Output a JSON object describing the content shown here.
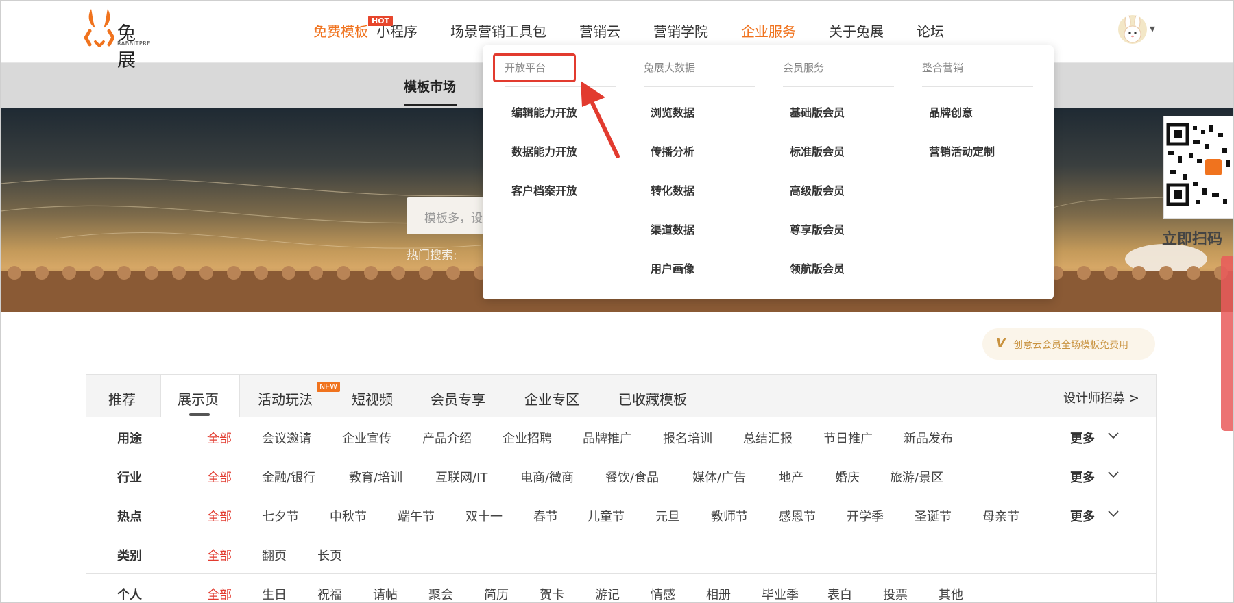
{
  "header": {
    "logo_text": "兔展",
    "logo_sub": "RABBITPRE",
    "nav": [
      {
        "label": "免费模板",
        "style": "orange"
      },
      {
        "label": "小程序"
      },
      {
        "label": "场景营销工具包"
      },
      {
        "label": "营销云"
      },
      {
        "label": "营销学院"
      },
      {
        "label": "企业服务",
        "style": "orange"
      },
      {
        "label": "关于兔展"
      },
      {
        "label": "论坛"
      }
    ],
    "hot_badge": "HOT",
    "avatar_caret": "▾"
  },
  "subbar": {
    "tab": "模板市场"
  },
  "hero": {
    "search_placeholder": "模板多，设",
    "hot_search": "热门搜索:",
    "qr_text": "立即扫码"
  },
  "dropdown": {
    "columns": [
      {
        "heading": "开放平台",
        "items": [
          "编辑能力开放",
          "数据能力开放",
          "客户档案开放"
        ]
      },
      {
        "heading": "兔展大数据",
        "items": [
          "浏览数据",
          "传播分析",
          "转化数据",
          "渠道数据",
          "用户画像"
        ]
      },
      {
        "heading": "会员服务",
        "items": [
          "基础版会员",
          "标准版会员",
          "高级版会员",
          "尊享版会员",
          "领航版会员"
        ]
      },
      {
        "heading": "整合营销",
        "items": [
          "品牌创意",
          "营销活动定制"
        ]
      }
    ]
  },
  "vip": {
    "icon": "V",
    "text": "创意云会员全场模板免费用"
  },
  "tabs": {
    "items": [
      "推荐",
      "展示页",
      "活动玩法",
      "短视频",
      "会员专享",
      "企业专区",
      "已收藏模板"
    ],
    "active_index": 1,
    "new_badge": "NEW",
    "designer": "设计师招募 >"
  },
  "filters": [
    {
      "label": "用途",
      "all": "全部",
      "items": [
        "会议邀请",
        "企业宣传",
        "产品介绍",
        "企业招聘",
        "品牌推广",
        "报名培训",
        "总结汇报",
        "节日推广",
        "新品发布"
      ],
      "more": "更多"
    },
    {
      "label": "行业",
      "all": "全部",
      "items": [
        "金融/银行",
        "教育/培训",
        "互联网/IT",
        "电商/微商",
        "餐饮/食品",
        "媒体/广告",
        "地产",
        "婚庆",
        "旅游/景区"
      ],
      "more": "更多"
    },
    {
      "label": "热点",
      "all": "全部",
      "items": [
        "七夕节",
        "中秋节",
        "端午节",
        "双十一",
        "春节",
        "儿童节",
        "元旦",
        "教师节",
        "感恩节",
        "开学季",
        "圣诞节",
        "母亲节"
      ],
      "more": "更多"
    },
    {
      "label": "类别",
      "all": "全部",
      "items": [
        "翻页",
        "长页"
      ],
      "more": ""
    },
    {
      "label": "个人",
      "all": "全部",
      "items": [
        "生日",
        "祝福",
        "请帖",
        "聚会",
        "简历",
        "贺卡",
        "游记",
        "情感",
        "相册",
        "毕业季",
        "表白",
        "投票",
        "其他"
      ],
      "more": ""
    }
  ],
  "colors": {
    "accent": "#f0731e",
    "red": "#e23b2f"
  }
}
